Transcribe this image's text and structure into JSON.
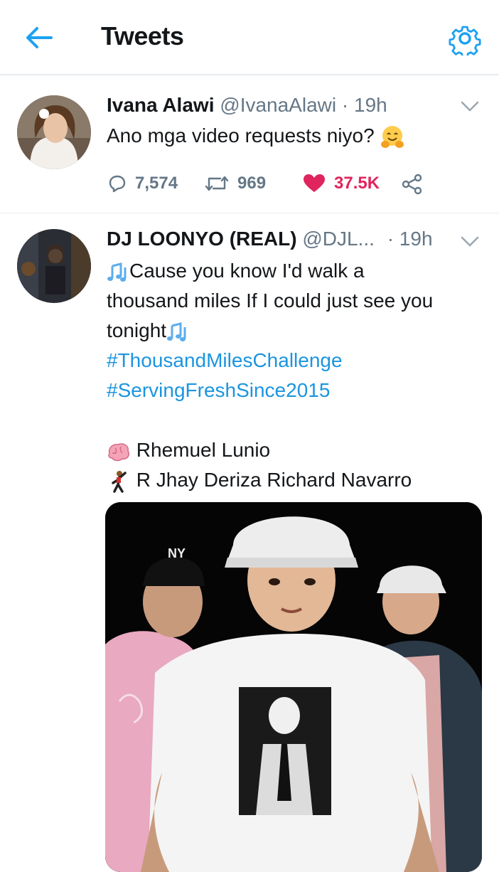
{
  "header": {
    "title": "Tweets",
    "back_icon": "arrow-left-icon",
    "settings_icon": "gear-icon",
    "accent": "#1da1f2"
  },
  "tweets": [
    {
      "display_name": "Ivana Alawi",
      "handle": "@IvanaAlawi",
      "separator": "·",
      "time": "19h",
      "text": "Ano mga video requests niyo?",
      "emoji": "hugging-face-emoji",
      "replies": "7,574",
      "retweets": "969",
      "likes": "37.5K",
      "liked": true,
      "like_color": "#e0245e"
    },
    {
      "display_name": "DJ LOONYO (REAL)",
      "handle": "@DJL...",
      "separator": "·",
      "time": "19h",
      "line1": "Cause you know I'd walk a",
      "line2": "thousand miles If I could just see you",
      "line3": "tonight",
      "hashtag1": "#ThousandMilesChallenge",
      "hashtag2": "#ServingFreshSince2015",
      "credit1": "Rhemuel Lunio",
      "credit2": "R Jhay Deriza Richard Navarro",
      "credit1_icon": "brain-emoji",
      "credit2_icon": "dancer-emoji",
      "music_icon": "musical-notes-emoji",
      "hashtag_color": "#1b95e0"
    }
  ]
}
